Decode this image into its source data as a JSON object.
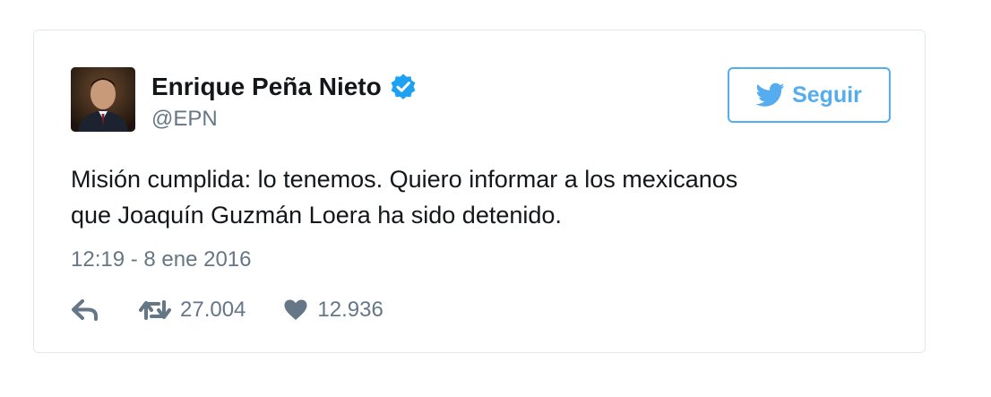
{
  "tweet": {
    "author_name": "Enrique Peña Nieto",
    "handle": "@EPN",
    "verified": true,
    "follow_label": "Seguir",
    "text_line1": "Misión cumplida: lo tenemos. Quiero informar a los mexicanos",
    "text_line2": "que Joaquín Guzmán Loera ha sido detenido.",
    "timestamp": "12:19 - 8 ene 2016",
    "retweets": "27.004",
    "likes": "12.936"
  },
  "icons": {
    "verified": "verified-badge-icon",
    "follow": "twitter-bird-icon",
    "reply": "reply-icon",
    "retweet": "retweet-icon",
    "like": "heart-icon"
  },
  "colors": {
    "accent": "#55acee",
    "verified": "#1da1f2",
    "text": "#14171a",
    "muted": "#657786",
    "border": "#e1e8ed"
  }
}
